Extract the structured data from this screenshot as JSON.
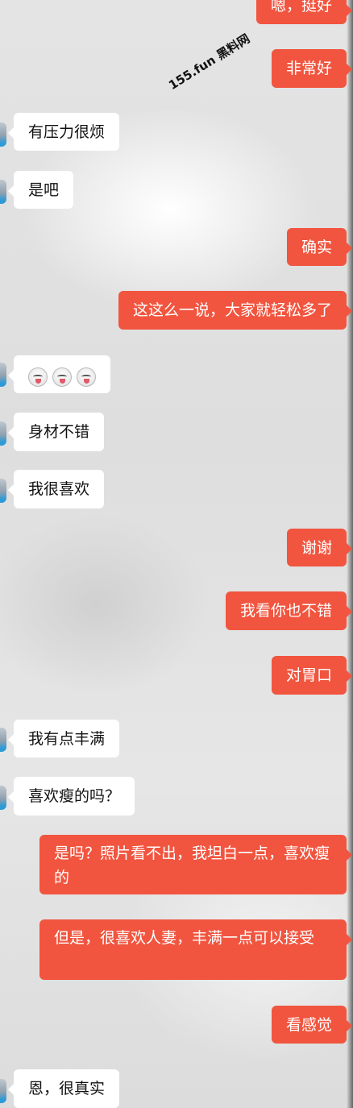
{
  "watermark": "155.fun 黑料网",
  "colors": {
    "sent_bubble": "#f1553f",
    "received_bubble": "#ffffff",
    "background": "#e4e4e4"
  },
  "messages": [
    {
      "side": "right",
      "text": "嗯，挺好"
    },
    {
      "side": "right",
      "text": "非常好"
    },
    {
      "side": "left",
      "text": "有压力很烦"
    },
    {
      "side": "left",
      "text": "是吧"
    },
    {
      "side": "right",
      "text": "确实"
    },
    {
      "side": "right",
      "text": "这这么一说，大家就轻松多了"
    },
    {
      "side": "left",
      "emoji": [
        "tongue-face-emoji",
        "tongue-face-emoji",
        "tongue-face-emoji"
      ]
    },
    {
      "side": "left",
      "text": "身材不错"
    },
    {
      "side": "left",
      "text": "我很喜欢"
    },
    {
      "side": "right",
      "text": "谢谢"
    },
    {
      "side": "right",
      "text": "我看你也不错"
    },
    {
      "side": "right",
      "text": "对胃口"
    },
    {
      "side": "left",
      "text": "我有点丰满"
    },
    {
      "side": "left",
      "text": "喜欢瘦的吗？"
    },
    {
      "side": "right",
      "text": "是吗？照片看不出，我坦白一点，喜欢瘦的"
    },
    {
      "side": "right",
      "text": "但是，很喜欢人妻，丰满一点可以接受"
    },
    {
      "side": "right",
      "text": "看感觉"
    },
    {
      "side": "left",
      "text": "恩，很真实"
    }
  ]
}
